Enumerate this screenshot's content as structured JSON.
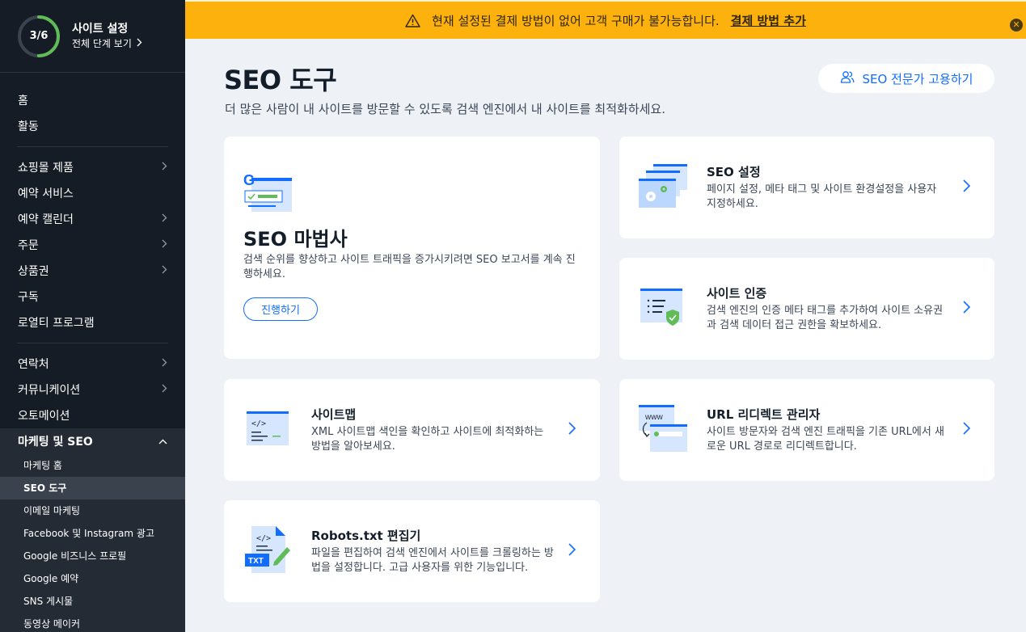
{
  "setup": {
    "progress_text": "3/6",
    "progress_fraction": 0.5,
    "title": "사이트 설정",
    "link": "전체 단계 보기"
  },
  "nav": {
    "group1": [
      {
        "label": "홈",
        "chevron": false
      },
      {
        "label": "활동",
        "chevron": false
      }
    ],
    "group2": [
      {
        "label": "쇼핑몰 제품",
        "chevron": true
      },
      {
        "label": "예약 서비스",
        "chevron": false
      },
      {
        "label": "예약 캘린더",
        "chevron": true
      },
      {
        "label": "주문",
        "chevron": true
      },
      {
        "label": "상품권",
        "chevron": true
      },
      {
        "label": "구독",
        "chevron": false
      },
      {
        "label": "로열티 프로그램",
        "chevron": false
      }
    ],
    "group3": [
      {
        "label": "연락처",
        "chevron": true
      },
      {
        "label": "커뮤니케이션",
        "chevron": true
      },
      {
        "label": "오토메이션",
        "chevron": false
      }
    ],
    "open_section": "마케팅 및 SEO",
    "sub_items": [
      "마케팅 홈",
      "SEO 도구",
      "이메일 마케팅",
      "Facebook 및 Instagram 광고",
      "Google 비즈니스 프로필",
      "Google 예약",
      "SNS 게시물",
      "동영상 메이커"
    ],
    "active_sub": "SEO 도구"
  },
  "banner": {
    "message": "현재 설정된 결제 방법이 없어 고객 구매가 불가능합니다.",
    "link": "결제 방법 추가",
    "color": "#fdb10c"
  },
  "page": {
    "title": "SEO 도구",
    "subtitle": "더 많은 사람이 내 사이트를 방문할 수 있도록 검색 엔진에서 내 사이트를 최적화하세요.",
    "hire_button": "SEO 전문가 고용하기"
  },
  "cards": {
    "wizard": {
      "title": "SEO 마법사",
      "desc": "검색 순위를 향상하고 사이트 트래픽을 증가시키려면 SEO 보고서를 계속 진행하세요.",
      "button": "진행하기"
    },
    "seo_settings": {
      "title": "SEO 설정",
      "desc": "페이지 설정, 메타 태그 및 사이트 환경설정을 사용자 지정하세요."
    },
    "site_verification": {
      "title": "사이트 인증",
      "desc": "검색 엔진의 인증 메타 태그를 추가하여 사이트 소유권과 검색 데이터 접근 권한을 확보하세요."
    },
    "sitemap": {
      "title": "사이트맵",
      "desc": "XML 사이트맵 색인을 확인하고 사이트에 최적화하는 방법을 알아보세요."
    },
    "url_redirect": {
      "title": "URL 리디렉트 관리자",
      "desc": "사이트 방문자와 검색 엔진 트래픽을 기존 URL에서 새로운 URL 경로로 리디렉트합니다."
    },
    "robots": {
      "title": "Robots.txt 편집기",
      "desc": "파일을 편집하여 검색 엔진에서 사이트를 크롤링하는 방법을 설정합니다. 고급 사용자를 위한 기능입니다."
    }
  },
  "icons": {
    "wizard_g_letter": "G",
    "www_label": "www",
    "txt_label": "TXT",
    "code_glyph": "</>"
  },
  "colors": {
    "accent": "#116dff",
    "progress": "#60bc57",
    "sidebar_bg": "#151c25",
    "warning": "#fdb10c"
  }
}
